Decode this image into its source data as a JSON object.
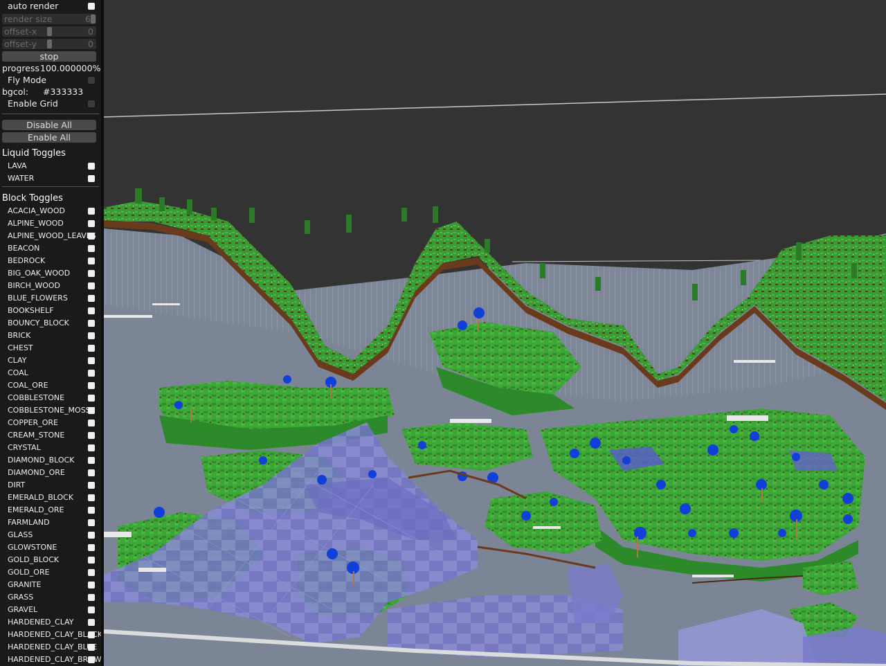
{
  "controls": {
    "auto_render": "auto render",
    "render_size_label": "render size",
    "render_size_value": "6",
    "offset_x_label": "offset-x",
    "offset_x_value": "0",
    "offset_y_label": "offset-y",
    "offset_y_value": "0",
    "stop_label": "stop",
    "progress_label": "progress",
    "progress_value": "100.000000%",
    "fly_mode": "Fly Mode",
    "bgcol_label": "bgcol:",
    "bgcol_value": "#333333",
    "enable_grid": "Enable Grid",
    "disable_all": "Disable All",
    "enable_all": "Enable All"
  },
  "liquid": {
    "title": "Liquid Toggles",
    "items": [
      "LAVA",
      "WATER"
    ]
  },
  "blocks": {
    "title": "Block Toggles",
    "items": [
      "ACACIA_WOOD",
      "ALPINE_WOOD",
      "ALPINE_WOOD_LEAVES",
      "BEACON",
      "BEDROCK",
      "BIG_OAK_WOOD",
      "BIRCH_WOOD",
      "BLUE_FLOWERS",
      "BOOKSHELF",
      "BOUNCY_BLOCK",
      "BRICK",
      "CHEST",
      "CLAY",
      "COAL",
      "COAL_ORE",
      "COBBLESTONE",
      "COBBLESTONE_MOSSY",
      "COPPER_ORE",
      "CREAM_STONE",
      "CRYSTAL",
      "DIAMOND_BLOCK",
      "DIAMOND_ORE",
      "DIRT",
      "EMERALD_BLOCK",
      "EMERALD_ORE",
      "FARMLAND",
      "GLASS",
      "GLOWSTONE",
      "GOLD_BLOCK",
      "GOLD_ORE",
      "GRANITE",
      "GRASS",
      "GRAVEL",
      "HARDENED_CLAY",
      "HARDENED_CLAY_BLACK",
      "HARDENED_CLAY_BLUE",
      "HARDENED_CLAY_BROWN"
    ]
  },
  "colors": {
    "background": "#333333",
    "grass": "#3fa83a",
    "water": "#7a7acc",
    "stone": "#7e8898",
    "dirt": "#6a3a1c",
    "flower": "#1040d8"
  }
}
